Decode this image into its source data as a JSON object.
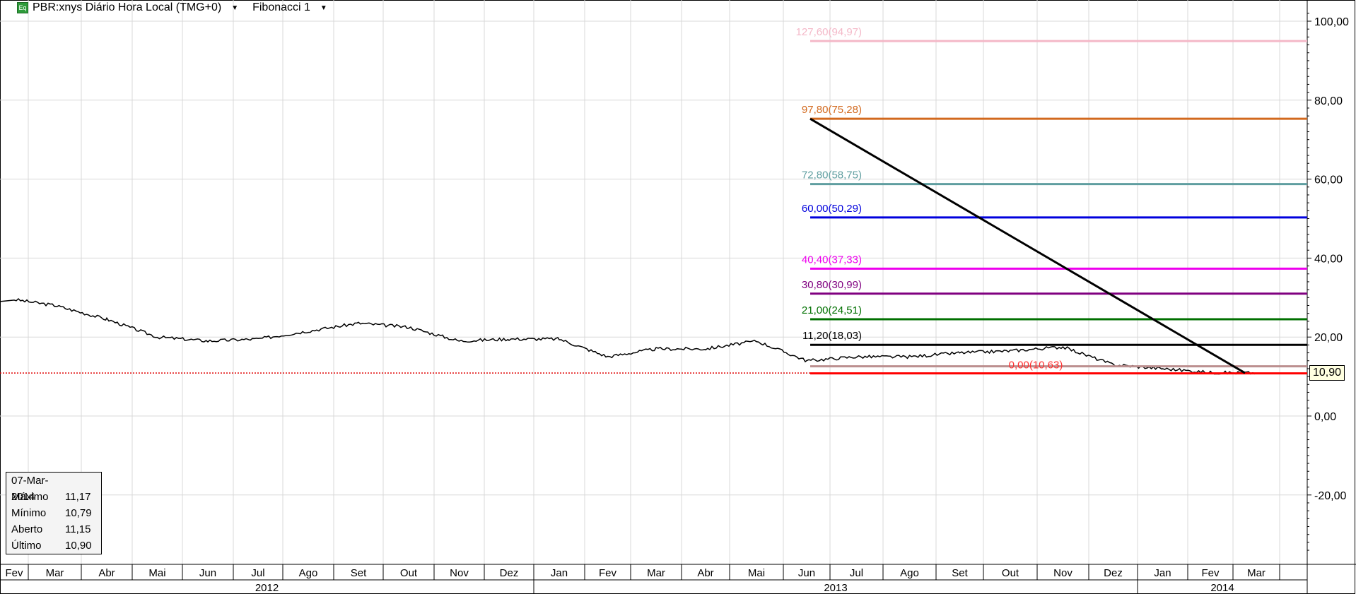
{
  "header": {
    "icon": "equity-icon",
    "icon_text": "Eq",
    "title": "PBR:xnys Diário Hora Local (TMG+0)",
    "study": "Fibonacci 1"
  },
  "info_box": {
    "date": "07-Mar-2014",
    "rows": [
      {
        "label": "Máximo",
        "value": "11,17"
      },
      {
        "label": "Mínimo",
        "value": "10,79"
      },
      {
        "label": "Aberto",
        "value": "11,15"
      },
      {
        "label": "Último",
        "value": "10,90"
      }
    ]
  },
  "last_price_label": "10,90",
  "chart_data": {
    "type": "line",
    "title": "PBR:xnys Diário Hora Local (TMG+0)",
    "ylim": [
      -35,
      103
    ],
    "y_ticks": [
      {
        "v": 100,
        "t": "100,00"
      },
      {
        "v": 80,
        "t": "80,00"
      },
      {
        "v": 60,
        "t": "60,00"
      },
      {
        "v": 40,
        "t": "40,00"
      },
      {
        "v": 20,
        "t": "20,00"
      },
      {
        "v": 0,
        "t": "0,00"
      },
      {
        "v": -20,
        "t": "-20,00"
      }
    ],
    "months": [
      "Fev",
      "Mar",
      "Abr",
      "Mai",
      "Jun",
      "Jul",
      "Ago",
      "Set",
      "Out",
      "Nov",
      "Dez",
      "Jan",
      "Fev",
      "Mar",
      "Abr",
      "Mai",
      "Jun",
      "Jul",
      "Ago",
      "Set",
      "Out",
      "Nov",
      "Dez",
      "Jan",
      "Fev",
      "Mar"
    ],
    "years": [
      "2012",
      "2013",
      "2014"
    ],
    "price_monthly": [
      29.5,
      28,
      24.5,
      20,
      19,
      19.5,
      21.5,
      23.5,
      22.5,
      19,
      19.5,
      19.5,
      15,
      17,
      17,
      19,
      14,
      15,
      15,
      16,
      16.5,
      17.5,
      13,
      12,
      11,
      10.9
    ],
    "last_price": 10.9,
    "fib_levels": [
      {
        "label": "127,60(94,97)",
        "value": 94.97,
        "color": "#f4b8c8"
      },
      {
        "label": "97,80(75,28)",
        "value": 75.28,
        "color": "#d2691e"
      },
      {
        "label": "72,80(58,75)",
        "value": 58.75,
        "color": "#5f9ea0"
      },
      {
        "label": "60,00(50,29)",
        "value": 50.29,
        "color": "#0000dd"
      },
      {
        "label": "40,40(37,33)",
        "value": 37.33,
        "color": "#ee00ee"
      },
      {
        "label": "30,80(30,99)",
        "value": 30.99,
        "color": "#800080"
      },
      {
        "label": "21,00(24,51)",
        "value": 24.51,
        "color": "#007000"
      },
      {
        "label": "11,20(18,03)",
        "value": 18.03,
        "color": "#000000"
      },
      {
        "label": "0,00(10,63)",
        "value": 12.6,
        "color": "#bc8f8f",
        "label_color": "#ff3030"
      }
    ],
    "trend_line": {
      "from": 75.28,
      "to": 10.9,
      "color": "#000000"
    }
  }
}
